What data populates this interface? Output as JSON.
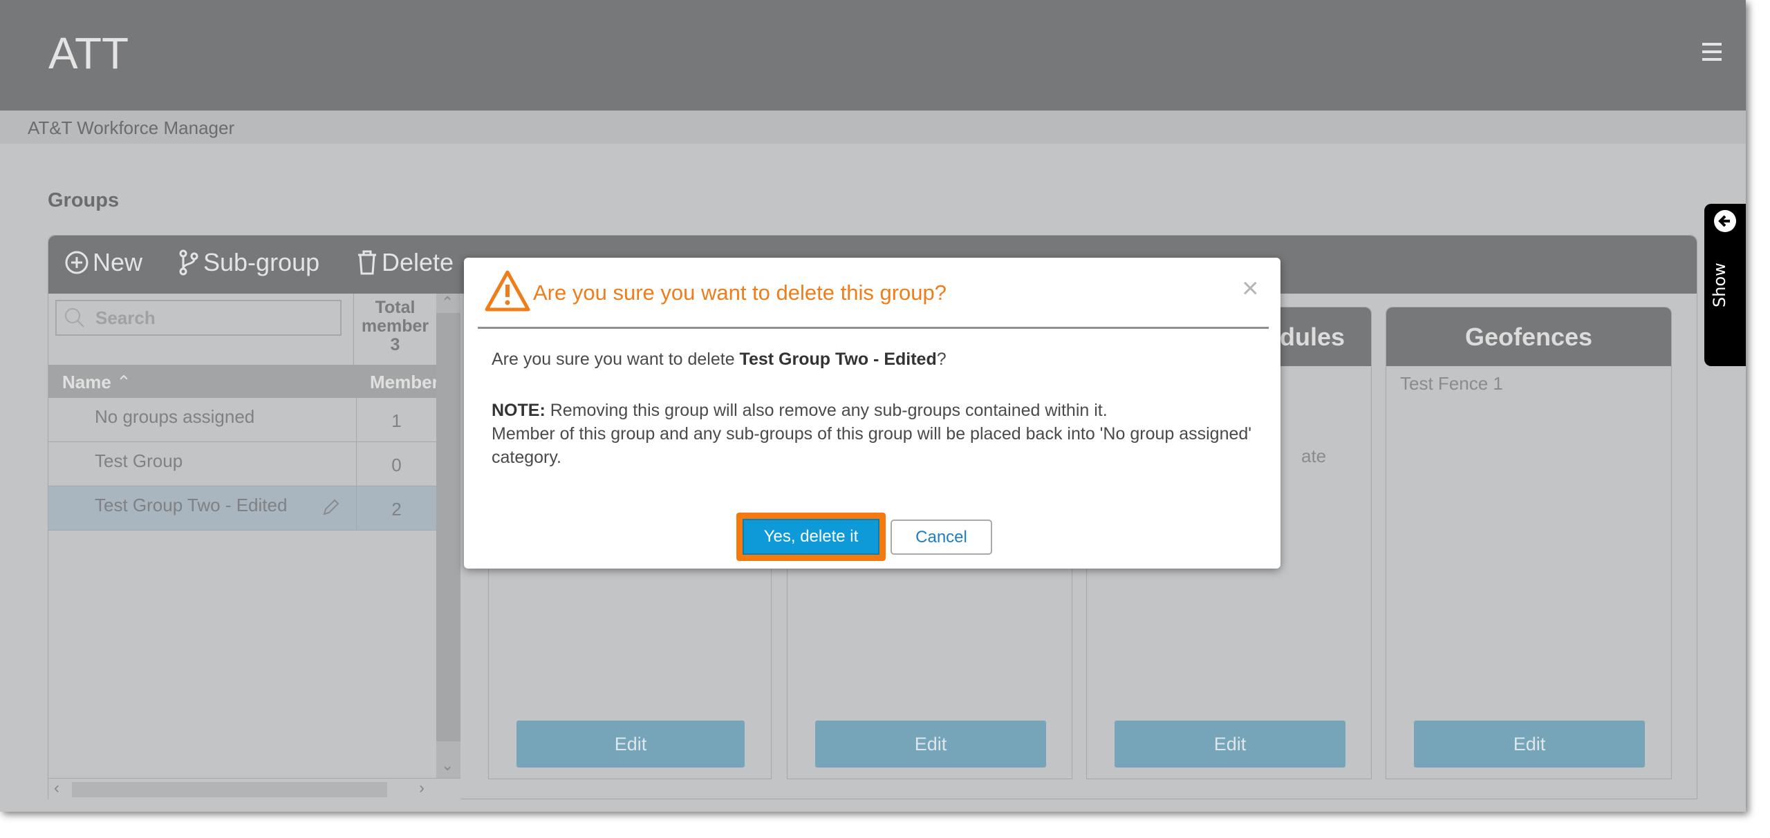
{
  "header": {
    "title": "ATT",
    "menu_icon": "hamburger-icon"
  },
  "subheader": {
    "title": "AT&T Workforce Manager"
  },
  "page": {
    "title": "Groups"
  },
  "toolbar": {
    "new_label": "New",
    "subgroup_label": "Sub-group",
    "delete_label": "Delete"
  },
  "list": {
    "search_placeholder": "Search",
    "total_label": "Total member",
    "total_value": "3",
    "name_header": "Name",
    "member_header": "Member",
    "rows": [
      {
        "name": "No groups assigned",
        "count": "1"
      },
      {
        "name": "Test Group",
        "count": "0"
      },
      {
        "name": "Test Group Two - Edited",
        "count": "2",
        "selected": true
      }
    ]
  },
  "cards": [
    {
      "title": "",
      "edit": "Edit"
    },
    {
      "title": "",
      "edit": "Edit"
    },
    {
      "title": "dules",
      "item": "ate",
      "edit": "Edit"
    },
    {
      "title": "Geofences",
      "item": "Test Fence 1",
      "edit": "Edit"
    }
  ],
  "side_tab": {
    "label": "Show"
  },
  "modal": {
    "title": "Are you sure you want to delete this group?",
    "q_prefix": "Are you sure you want to delete ",
    "q_group": "Test Group Two - Edited",
    "q_suffix": "?",
    "note_label": "NOTE:",
    "note_line1": " Removing this group will also remove any sub-groups contained within it.",
    "note_line2": "Member of this group and any sub-groups of this group will be placed back into 'No group assigned' category.",
    "confirm": "Yes, delete it",
    "cancel": "Cancel"
  },
  "colors": {
    "accent_orange": "#ef7d1a",
    "confirm_blue": "#0e9ad9",
    "highlight": "#f47a10"
  }
}
